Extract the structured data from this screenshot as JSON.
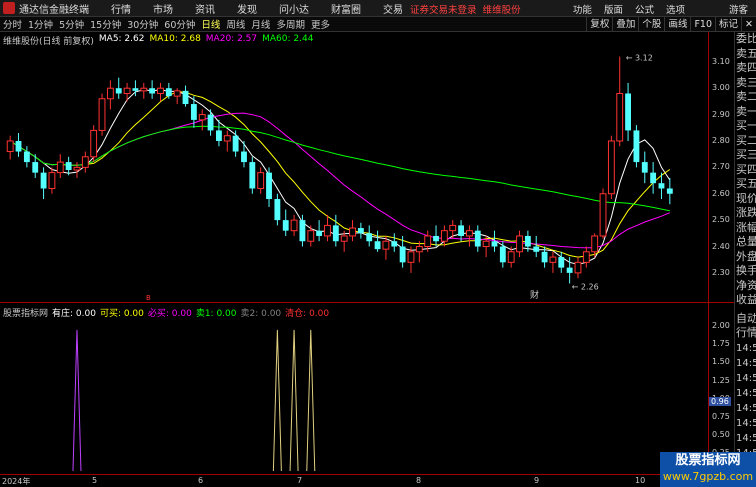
{
  "app": {
    "name": "通达信金融终端",
    "menu": [
      "行情",
      "市场",
      "资讯",
      "发现",
      "问小达",
      "财富圈",
      "交易"
    ],
    "notice": "证券交易未登录",
    "notice2": "维维股份",
    "right_menu": [
      "功能",
      "版面",
      "公式",
      "选项"
    ],
    "guest": "游客"
  },
  "toolbar": {
    "periods": [
      "分时",
      "1分钟",
      "5分钟",
      "15分钟",
      "30分钟",
      "60分钟",
      "日线",
      "周线",
      "月线",
      "多周期",
      "更多"
    ],
    "active_period": "日线",
    "right_buttons": [
      "复权",
      "叠加",
      "个股",
      "画线",
      "F10",
      "标记"
    ]
  },
  "main_chart": {
    "stock_name": "维维股份(日线 前复权)",
    "ma": [
      {
        "label": "MA5: 2.62",
        "color": "#ffffff"
      },
      {
        "label": "MA10: 2.68",
        "color": "#ffff00"
      },
      {
        "label": "MA20: 2.57",
        "color": "#ff00ff"
      },
      {
        "label": "MA60: 2.44",
        "color": "#00ff00"
      }
    ],
    "price_ticks": [
      "3.10",
      "3.00",
      "2.90",
      "2.80",
      "2.70",
      "2.60",
      "2.50",
      "2.40",
      "2.30"
    ],
    "high_label": "3.12",
    "low_label": "2.26",
    "event_marker": "财",
    "event_marker2": "B"
  },
  "indicator": {
    "name": "股票指标网",
    "items": [
      {
        "label": "有庄: 0.00",
        "color": "#ffffff"
      },
      {
        "label": "可买: 0.00",
        "color": "#ffff00"
      },
      {
        "label": "必买: 0.00",
        "color": "#ff00ff"
      },
      {
        "label": "卖1: 0.00",
        "color": "#00ff00"
      },
      {
        "label": "卖2: 0.00",
        "color": "#808080"
      },
      {
        "label": "清仓: 0.00",
        "color": "#ff3030"
      }
    ],
    "ticks": [
      "2.00",
      "1.75",
      "1.50",
      "1.25",
      "1.00",
      "0.75",
      "0.50",
      "0.25"
    ],
    "current_value": "0.96"
  },
  "dates": [
    "2024年",
    "5",
    "6",
    "7",
    "8",
    "9",
    "10"
  ],
  "side_panel": {
    "items": [
      "委比",
      "卖五",
      "卖四",
      "卖三",
      "卖二",
      "卖一",
      "买一",
      "买二",
      "买三",
      "买四",
      "买五",
      "现价",
      "涨跌",
      "涨幅",
      "总量",
      "外盘",
      "换手",
      "净资",
      "收益"
    ],
    "lower": [
      "自动",
      "行情"
    ],
    "times": [
      "14:50",
      "14:50",
      "14:50",
      "14:50",
      "14:50",
      "14:50",
      "14:50",
      "14:50",
      "14:50",
      "14:50"
    ]
  },
  "watermark": {
    "title": "股票指标网",
    "url": "www.7gpzb.com"
  },
  "chart_data": {
    "type": "candlestick",
    "y_range": [
      2.22,
      3.16
    ],
    "candles": [
      [
        2.76,
        2.82,
        2.73,
        2.8
      ],
      [
        2.8,
        2.83,
        2.74,
        2.76
      ],
      [
        2.76,
        2.78,
        2.7,
        2.72
      ],
      [
        2.72,
        2.75,
        2.66,
        2.68
      ],
      [
        2.68,
        2.7,
        2.58,
        2.62
      ],
      [
        2.62,
        2.7,
        2.6,
        2.68
      ],
      [
        2.68,
        2.75,
        2.66,
        2.72
      ],
      [
        2.72,
        2.74,
        2.67,
        2.69
      ],
      [
        2.69,
        2.72,
        2.66,
        2.7
      ],
      [
        2.7,
        2.76,
        2.68,
        2.74
      ],
      [
        2.74,
        2.86,
        2.72,
        2.84
      ],
      [
        2.84,
        2.98,
        2.82,
        2.96
      ],
      [
        2.96,
        3.03,
        2.92,
        3.0
      ],
      [
        3.0,
        3.04,
        2.96,
        2.98
      ],
      [
        2.98,
        3.02,
        2.95,
        3.0
      ],
      [
        3.0,
        3.03,
        2.97,
        2.99
      ],
      [
        2.99,
        3.02,
        2.96,
        3.0
      ],
      [
        3.0,
        3.03,
        2.96,
        2.98
      ],
      [
        2.98,
        3.02,
        2.95,
        3.0
      ],
      [
        3.0,
        3.02,
        2.96,
        2.97
      ],
      [
        2.97,
        3.0,
        2.94,
        2.99
      ],
      [
        2.99,
        3.01,
        2.93,
        2.94
      ],
      [
        2.94,
        2.97,
        2.85,
        2.88
      ],
      [
        2.88,
        2.92,
        2.84,
        2.9
      ],
      [
        2.9,
        2.92,
        2.82,
        2.84
      ],
      [
        2.84,
        2.88,
        2.78,
        2.8
      ],
      [
        2.8,
        2.84,
        2.76,
        2.82
      ],
      [
        2.82,
        2.84,
        2.74,
        2.76
      ],
      [
        2.76,
        2.8,
        2.7,
        2.72
      ],
      [
        2.72,
        2.74,
        2.6,
        2.62
      ],
      [
        2.62,
        2.7,
        2.6,
        2.68
      ],
      [
        2.68,
        2.7,
        2.55,
        2.58
      ],
      [
        2.58,
        2.6,
        2.48,
        2.5
      ],
      [
        2.5,
        2.54,
        2.44,
        2.46
      ],
      [
        2.46,
        2.52,
        2.44,
        2.5
      ],
      [
        2.5,
        2.52,
        2.4,
        2.42
      ],
      [
        2.42,
        2.48,
        2.4,
        2.46
      ],
      [
        2.46,
        2.5,
        2.42,
        2.44
      ],
      [
        2.44,
        2.52,
        2.42,
        2.48
      ],
      [
        2.48,
        2.52,
        2.4,
        2.42
      ],
      [
        2.42,
        2.46,
        2.38,
        2.44
      ],
      [
        2.44,
        2.5,
        2.42,
        2.47
      ],
      [
        2.47,
        2.49,
        2.43,
        2.45
      ],
      [
        2.45,
        2.48,
        2.4,
        2.42
      ],
      [
        2.42,
        2.46,
        2.38,
        2.39
      ],
      [
        2.39,
        2.44,
        2.35,
        2.42
      ],
      [
        2.42,
        2.45,
        2.38,
        2.4
      ],
      [
        2.4,
        2.44,
        2.32,
        2.34
      ],
      [
        2.34,
        2.4,
        2.3,
        2.38
      ],
      [
        2.38,
        2.42,
        2.34,
        2.4
      ],
      [
        2.4,
        2.46,
        2.38,
        2.44
      ],
      [
        2.44,
        2.48,
        2.4,
        2.42
      ],
      [
        2.42,
        2.48,
        2.4,
        2.46
      ],
      [
        2.46,
        2.5,
        2.43,
        2.48
      ],
      [
        2.48,
        2.5,
        2.42,
        2.44
      ],
      [
        2.44,
        2.48,
        2.4,
        2.46
      ],
      [
        2.46,
        2.48,
        2.38,
        2.4
      ],
      [
        2.4,
        2.44,
        2.36,
        2.42
      ],
      [
        2.42,
        2.46,
        2.38,
        2.4
      ],
      [
        2.4,
        2.42,
        2.32,
        2.34
      ],
      [
        2.34,
        2.4,
        2.32,
        2.38
      ],
      [
        2.38,
        2.46,
        2.36,
        2.44
      ],
      [
        2.44,
        2.46,
        2.38,
        2.4
      ],
      [
        2.4,
        2.44,
        2.36,
        2.38
      ],
      [
        2.38,
        2.4,
        2.32,
        2.34
      ],
      [
        2.34,
        2.38,
        2.3,
        2.36
      ],
      [
        2.36,
        2.38,
        2.3,
        2.32
      ],
      [
        2.32,
        2.36,
        2.26,
        2.3
      ],
      [
        2.3,
        2.36,
        2.28,
        2.34
      ],
      [
        2.34,
        2.4,
        2.32,
        2.38
      ],
      [
        2.38,
        2.45,
        2.36,
        2.44
      ],
      [
        2.44,
        2.62,
        2.43,
        2.6
      ],
      [
        2.6,
        2.82,
        2.58,
        2.8
      ],
      [
        2.8,
        3.12,
        2.78,
        2.98
      ],
      [
        2.98,
        3.02,
        2.8,
        2.84
      ],
      [
        2.84,
        2.86,
        2.7,
        2.72
      ],
      [
        2.72,
        2.76,
        2.64,
        2.68
      ],
      [
        2.68,
        2.72,
        2.6,
        2.64
      ],
      [
        2.64,
        2.68,
        2.58,
        2.62
      ],
      [
        2.62,
        2.66,
        2.56,
        2.6
      ]
    ],
    "indicator_spikes": [
      {
        "index": 8,
        "value": 1.95,
        "color": "#c040ff"
      },
      {
        "index": 32,
        "value": 1.95,
        "color": "#e0d080"
      },
      {
        "index": 34,
        "value": 1.95,
        "color": "#e0d080"
      },
      {
        "index": 36,
        "value": 1.95,
        "color": "#e0d080"
      }
    ],
    "indicator_range": [
      0,
      2.1
    ]
  }
}
